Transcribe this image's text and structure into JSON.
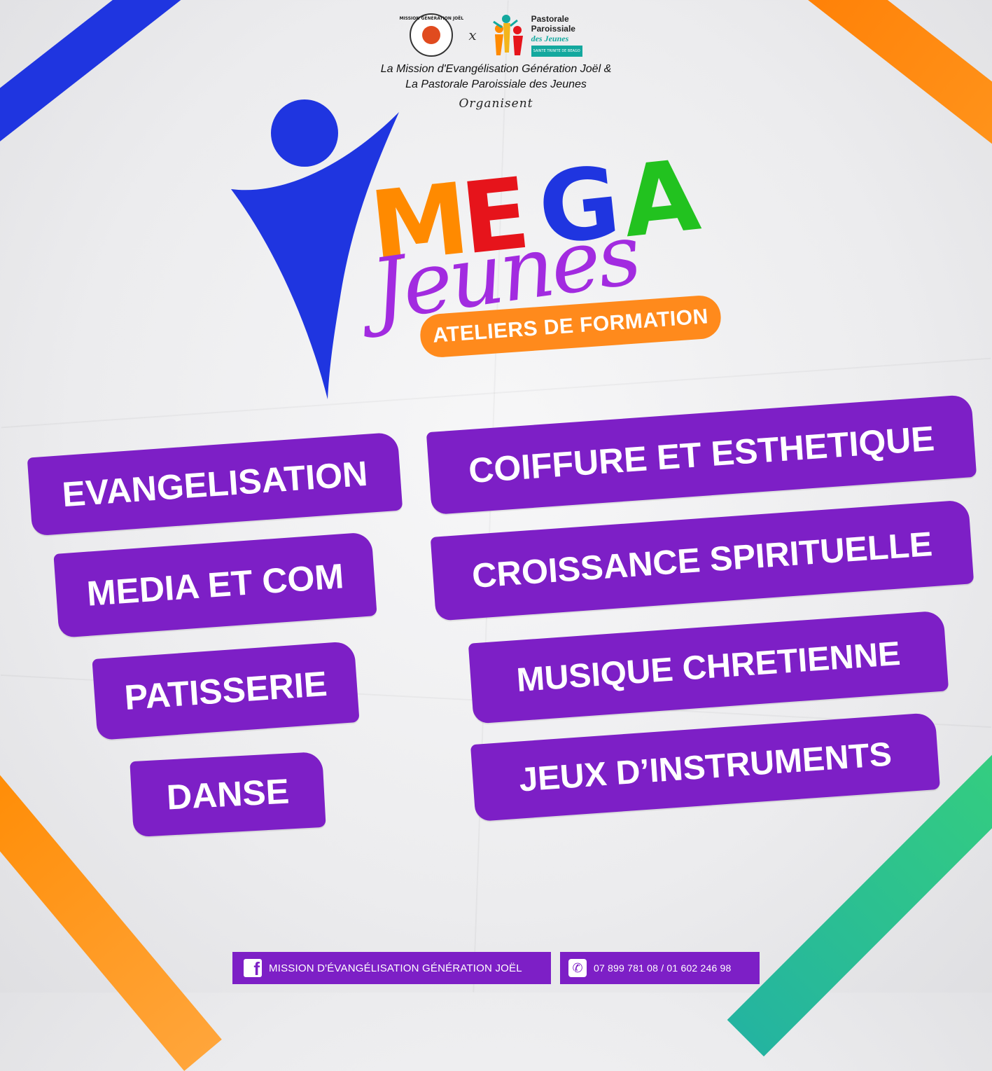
{
  "header": {
    "mission_logo_text": "MISSION GÉNÉRATION JOËL",
    "x_symbol": "x",
    "pastorale_line1": "Pastorale",
    "pastorale_line2": "Paroissiale",
    "pastorale_line3": "des Jeunes",
    "pastorale_sub": "SAINTE TRINITE DE BEAGO",
    "org_line1": "La Mission d'Evangélisation Génération Joël &",
    "org_line2": "La Pastorale Paroissiale des Jeunes",
    "organisent": "Organisent"
  },
  "hero": {
    "mega_letters": [
      "M",
      "E",
      "G",
      "A"
    ],
    "mega_colors": [
      "#ff8a00",
      "#e6141b",
      "#1f35e0",
      "#22c21f"
    ],
    "jeunes": "Jeunes",
    "ateliers": "ATELIERS DE FORMATION",
    "figure_color": "#1f35e0"
  },
  "workshops": {
    "left": [
      "EVANGELISATION",
      "MEDIA ET COM",
      "PATISSERIE",
      "DANSE"
    ],
    "right": [
      "COIFFURE ET ESTHETIQUE",
      "CROISSANCE SPIRITUELLE",
      "MUSIQUE CHRETIENNE",
      "JEUX D’INSTRUMENTS"
    ]
  },
  "footer": {
    "facebook_icon": "facebook-icon",
    "facebook_label": "MISSION D'ÉVANGÉLISATION GÉNÉRATION JOËL",
    "phone_icon": "phone-icon",
    "phone": "07 899 781 08 / 01 602 246 98"
  },
  "colors": {
    "purple": "#7d1fc6",
    "orange": "#ff8a00",
    "blue": "#1f35e0",
    "green": "#22c21f",
    "red": "#e6141b"
  }
}
